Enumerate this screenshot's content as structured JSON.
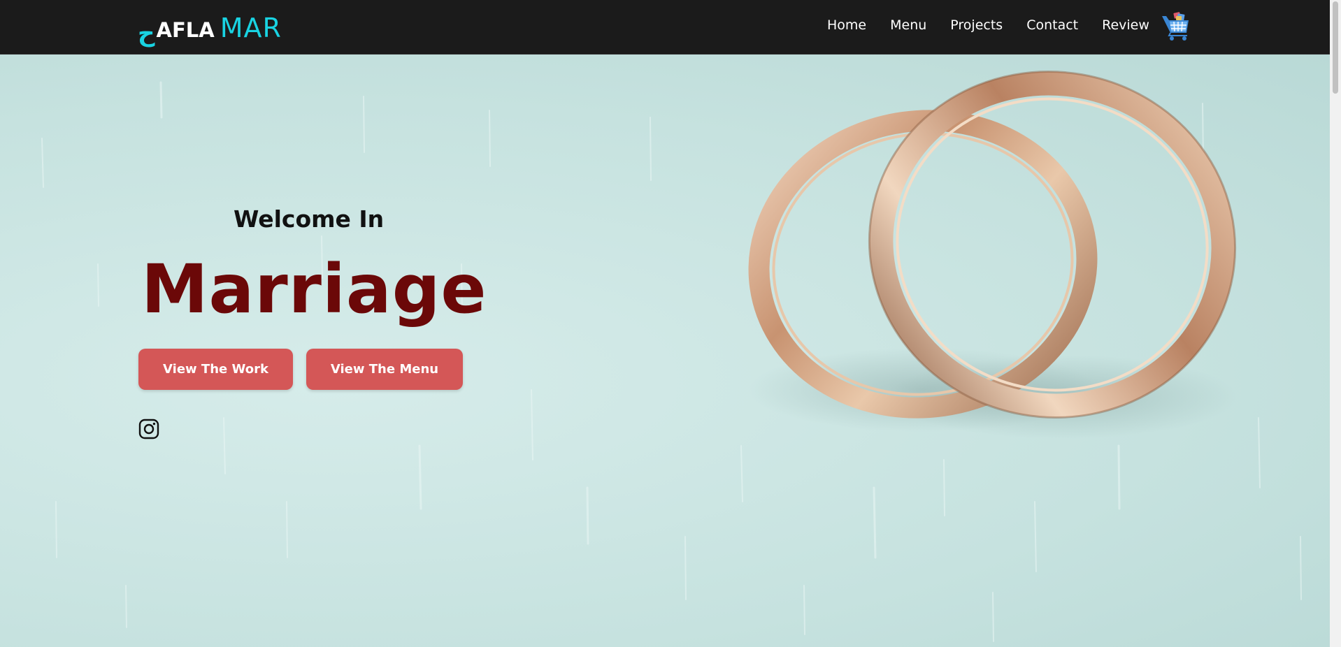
{
  "nav": {
    "logo": {
      "arabic": "ح",
      "afla": "AFLA",
      "mar": "MAR"
    },
    "links": [
      {
        "label": "Home"
      },
      {
        "label": "Menu"
      },
      {
        "label": "Projects"
      },
      {
        "label": "Contact"
      },
      {
        "label": "Review"
      }
    ],
    "cart_icon": "shopping-cart-icon"
  },
  "hero": {
    "welcome": "Welcome In",
    "headline": "Marriage",
    "buttons": {
      "work": "View The Work",
      "menu": "View The Menu"
    },
    "social_icon": "instagram-icon",
    "image": "wedding-rings-image"
  },
  "colors": {
    "navbar_bg": "#1b1b1b",
    "brand_accent": "#19d3e2",
    "headline": "#6b0808",
    "button_bg": "#d45757",
    "hero_bg": "#c9e4e1"
  }
}
